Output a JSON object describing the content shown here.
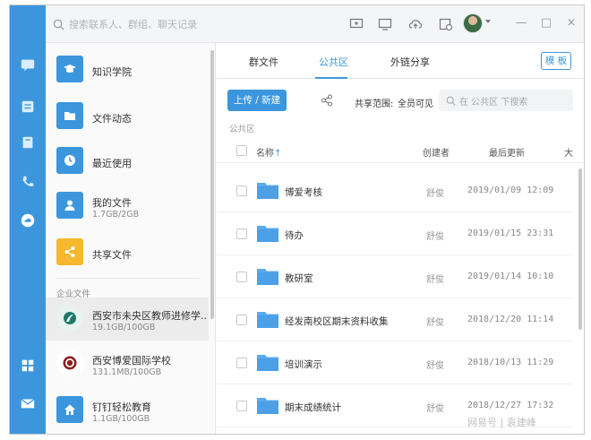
{
  "topbar": {
    "search_placeholder": "搜索联系人、群组、聊天记录",
    "window_controls": [
      "—",
      "□",
      "×"
    ]
  },
  "rail": {
    "icons": [
      "chat-icon",
      "work-icon",
      "contacts-icon",
      "phone-icon",
      "cloud-icon",
      "apps-icon",
      "mail-icon"
    ],
    "accent": "#3c96dd"
  },
  "leftpanel": {
    "nav": [
      {
        "label": "知识学院",
        "sub": "",
        "color": "#3c96dd",
        "icon": "graduation-cap-icon"
      },
      {
        "label": "文件动态",
        "sub": "",
        "color": "#3c96dd",
        "icon": "folder-icon"
      },
      {
        "label": "最近使用",
        "sub": "",
        "color": "#3c96dd",
        "icon": "clock-icon"
      },
      {
        "label": "我的文件",
        "sub": "1.7GB/2GB",
        "color": "#3c96dd",
        "icon": "user-icon"
      },
      {
        "label": "共享文件",
        "sub": "",
        "color": "#f5b82e",
        "icon": "share-icon"
      }
    ],
    "section_label": "企业文件",
    "orgs": [
      {
        "label": "西安市未央区教师进修学...",
        "sub": "19.1GB/100GB"
      },
      {
        "label": "西安博爱国际学校",
        "sub": "131.1MB/100GB"
      },
      {
        "label": "钉钉轻松教育",
        "sub": "1.1GB/100GB"
      }
    ]
  },
  "main": {
    "tabs": [
      "群文件",
      "公共区",
      "外链分享"
    ],
    "active_tab": 1,
    "template_label": "模 板",
    "upload_label": "上传 / 新建",
    "scope_label": "共享范围:",
    "scope_value": "全员可见",
    "search_placeholder": "在 公共区 下搜索",
    "breadcrumb": "公共区",
    "columns": {
      "name": "名称",
      "sort": "↑",
      "creator": "创建者",
      "updated": "最后更新",
      "size": "大"
    },
    "rows": [
      {
        "name": "博爱考核",
        "creator": "舒俊",
        "time": "2019/01/09 12:09"
      },
      {
        "name": "待办",
        "creator": "舒俊",
        "time": "2019/01/15 23:31"
      },
      {
        "name": "教研室",
        "creator": "舒俊",
        "time": "2019/01/14 10:10"
      },
      {
        "name": "经发南校区期末资料收集",
        "creator": "舒俊",
        "time": "2018/12/20 11:14"
      },
      {
        "name": "培训演示",
        "creator": "舒俊",
        "time": "2018/10/13 11:29"
      },
      {
        "name": "期末成绩统计",
        "creator": "舒俊",
        "time": "2018/12/27 17:32"
      }
    ]
  },
  "watermark": "网易号 | 袁建峰"
}
